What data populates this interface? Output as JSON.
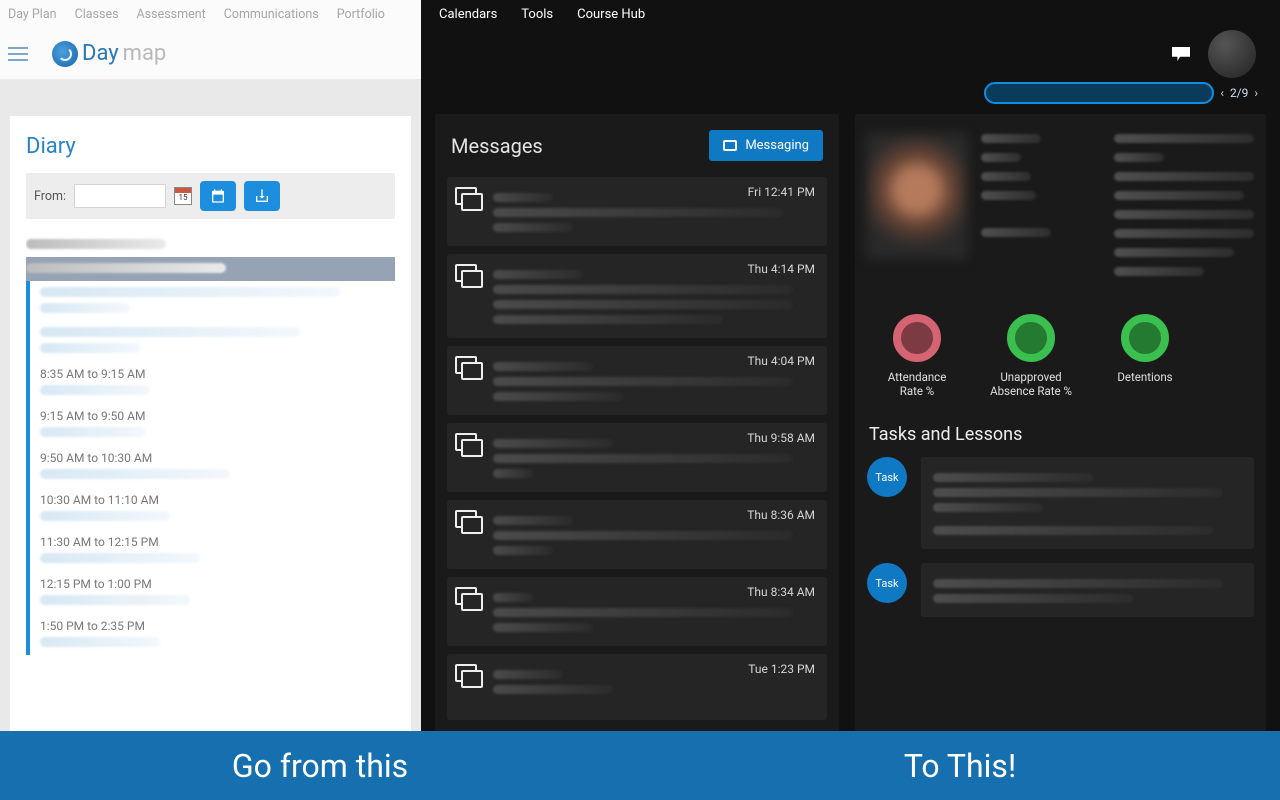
{
  "left": {
    "nav": [
      "Day Plan",
      "Classes",
      "Assessment",
      "Communications",
      "Portfolio"
    ],
    "brand": {
      "name": "Day",
      "suffix": "map"
    },
    "diary": {
      "title": "Diary",
      "from_label": "From:",
      "cal_num": "15",
      "slots": [
        "8:35 AM to 9:15 AM",
        "9:15 AM to 9:50 AM",
        "9:50 AM to 10:30 AM",
        "10:30 AM to 11:10 AM",
        "11:30 AM to 12:15 PM",
        "12:15 PM to 1:00 PM",
        "1:50 PM to 2:35 PM"
      ]
    }
  },
  "right": {
    "nav": [
      "Calendars",
      "Tools",
      "Course Hub"
    ],
    "pager": "2/9",
    "messages": {
      "title": "Messages",
      "button": "Messaging",
      "items": [
        {
          "time": "Fri 12:41 PM"
        },
        {
          "time": "Thu 4:14 PM"
        },
        {
          "time": "Thu 4:04 PM"
        },
        {
          "time": "Thu 9:58 AM"
        },
        {
          "time": "Thu 8:36 AM"
        },
        {
          "time": "Thu 8:34 AM"
        },
        {
          "time": "Tue 1:23 PM"
        }
      ]
    },
    "metrics": [
      {
        "label": "Attendance Rate %",
        "color": "red"
      },
      {
        "label": "Unapproved Absence Rate %",
        "color": "green"
      },
      {
        "label": "Detentions",
        "color": "green"
      }
    ],
    "tasks": {
      "title": "Tasks and Lessons",
      "badge": "Task",
      "items": [
        1,
        2
      ]
    }
  },
  "banner": {
    "left": "Go from this",
    "right": "To This!"
  }
}
